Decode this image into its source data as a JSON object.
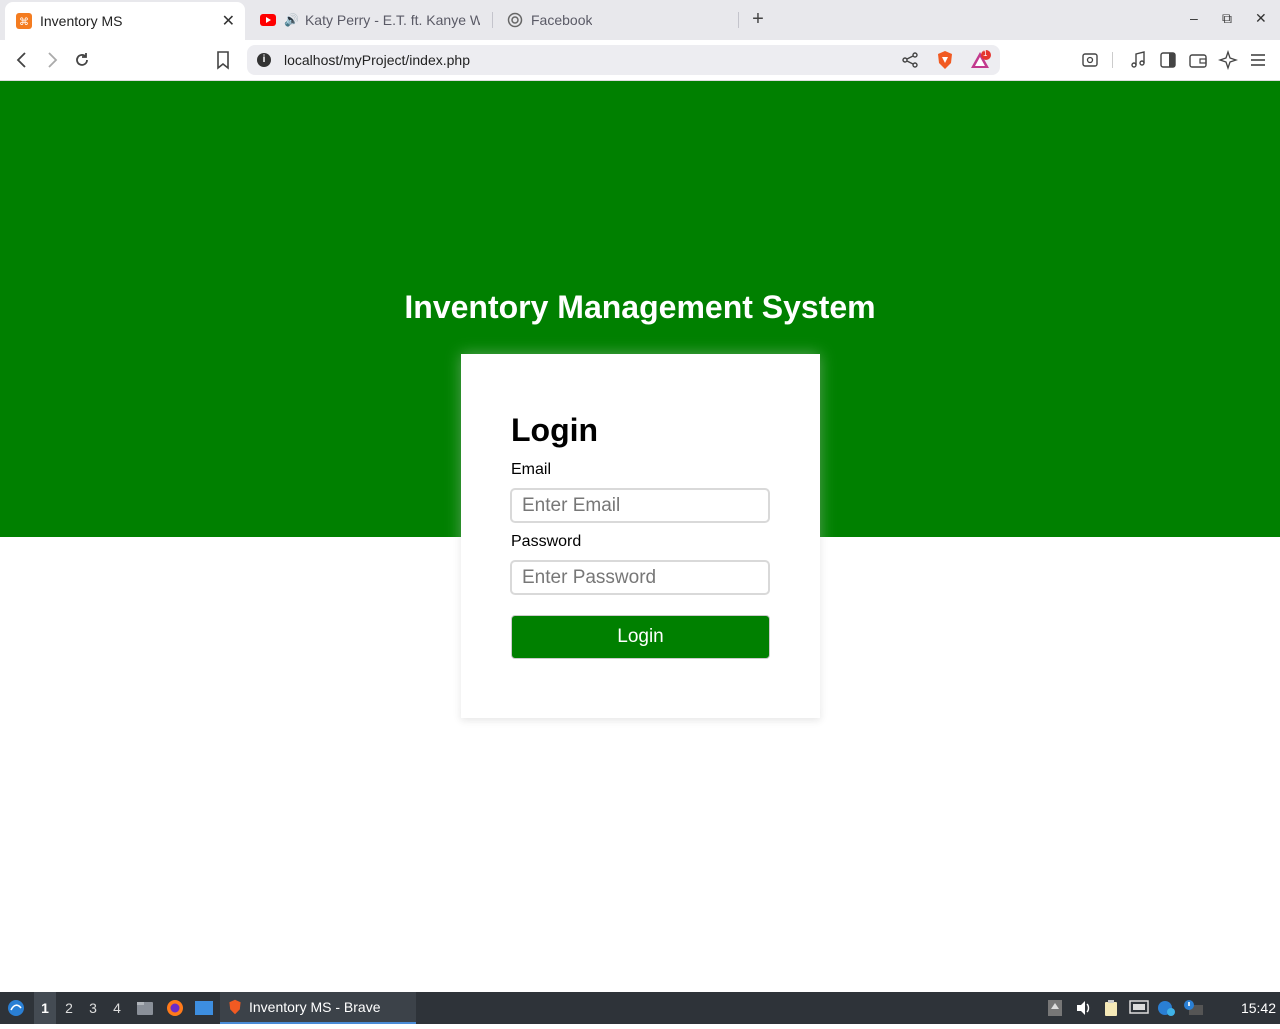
{
  "browser": {
    "tabs": [
      {
        "label": "Inventory MS",
        "active": true
      },
      {
        "label": "Katy Perry - E.T. ft. Kanye W",
        "active": false,
        "audio": true
      },
      {
        "label": "Facebook",
        "active": false
      }
    ],
    "new_tab": "+",
    "url": "localhost/myProject/index.php",
    "badge_count": "1",
    "window_controls": {
      "minimize": "–",
      "restore": "⧉",
      "close": "✕"
    }
  },
  "page": {
    "header_title": "Inventory Management System",
    "login": {
      "heading": "Login",
      "email_label": "Email",
      "email_placeholder": "Enter Email",
      "password_label": "Password",
      "password_placeholder": "Enter Password",
      "submit_label": "Login"
    },
    "colors": {
      "brand_green": "#008000",
      "white": "#ffffff"
    }
  },
  "taskbar": {
    "workspaces": [
      "1",
      "2",
      "3",
      "4"
    ],
    "active_workspace": "1",
    "active_window": "Inventory MS - Brave",
    "clock": "15:42"
  }
}
